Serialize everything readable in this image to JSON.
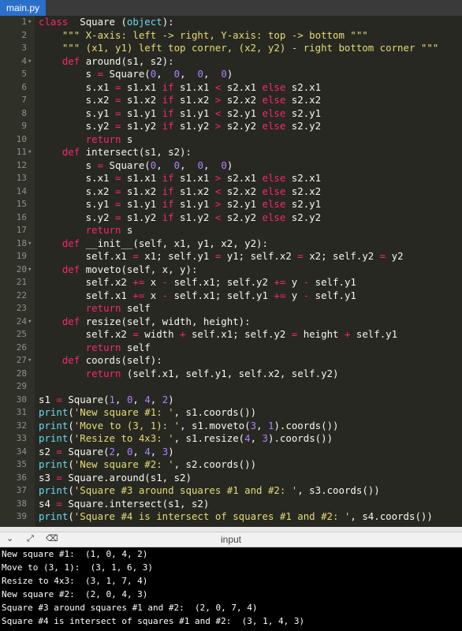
{
  "tab": {
    "filename": "main.py"
  },
  "editor": {
    "lines": [
      {
        "n": "1",
        "fold": "▾",
        "tokens": [
          [
            "kw",
            "class"
          ],
          [
            "",
            "  Square ("
          ],
          [
            "df",
            "object"
          ],
          [
            "",
            "):"
          ]
        ]
      },
      {
        "n": "2",
        "fold": "",
        "tokens": [
          [
            "",
            "    "
          ],
          [
            "st",
            "\"\"\" X-axis: left -> right, Y-axis: top -> bottom \"\"\""
          ]
        ]
      },
      {
        "n": "3",
        "fold": "",
        "tokens": [
          [
            "",
            "    "
          ],
          [
            "st",
            "\"\"\" (x1, y1) left top corner, (x2, y2) - right bottom corner \"\"\""
          ]
        ]
      },
      {
        "n": "4",
        "fold": "▾",
        "tokens": [
          [
            "",
            "    "
          ],
          [
            "kw",
            "def"
          ],
          [
            "",
            " around(s1, s2):"
          ]
        ]
      },
      {
        "n": "5",
        "fold": "",
        "tokens": [
          [
            "",
            "        s "
          ],
          [
            "op",
            "="
          ],
          [
            "",
            " Square("
          ],
          [
            "nu",
            "0"
          ],
          [
            ",",
            "  "
          ],
          [
            "nu",
            "0"
          ],
          [
            "",
            ",  "
          ],
          [
            "nu",
            "0"
          ],
          [
            "",
            ",  "
          ],
          [
            "nu",
            "0"
          ],
          [
            "",
            ")"
          ]
        ]
      },
      {
        "n": "6",
        "fold": "",
        "tokens": [
          [
            "",
            "        s.x1 "
          ],
          [
            "op",
            "="
          ],
          [
            "",
            " s1.x1 "
          ],
          [
            "kw",
            "if"
          ],
          [
            "",
            " s1.x1 "
          ],
          [
            "op",
            "<"
          ],
          [
            "",
            " s2.x1 "
          ],
          [
            "kw",
            "else"
          ],
          [
            "",
            " s2.x1"
          ]
        ]
      },
      {
        "n": "7",
        "fold": "",
        "tokens": [
          [
            "",
            "        s.x2 "
          ],
          [
            "op",
            "="
          ],
          [
            "",
            " s1.x2 "
          ],
          [
            "kw",
            "if"
          ],
          [
            "",
            " s1.x2 "
          ],
          [
            "op",
            ">"
          ],
          [
            "",
            " s2.x2 "
          ],
          [
            "kw",
            "else"
          ],
          [
            "",
            " s2.x2"
          ]
        ]
      },
      {
        "n": "8",
        "fold": "",
        "tokens": [
          [
            "",
            "        s.y1 "
          ],
          [
            "op",
            "="
          ],
          [
            "",
            " s1.y1 "
          ],
          [
            "kw",
            "if"
          ],
          [
            "",
            " s1.y1 "
          ],
          [
            "op",
            "<"
          ],
          [
            "",
            " s2.y1 "
          ],
          [
            "kw",
            "else"
          ],
          [
            "",
            " s2.y1"
          ]
        ]
      },
      {
        "n": "9",
        "fold": "",
        "tokens": [
          [
            "",
            "        s.y2 "
          ],
          [
            "op",
            "="
          ],
          [
            "",
            " s1.y2 "
          ],
          [
            "kw",
            "if"
          ],
          [
            "",
            " s1.y2 "
          ],
          [
            "op",
            ">"
          ],
          [
            "",
            " s2.y2 "
          ],
          [
            "kw",
            "else"
          ],
          [
            "",
            " s2.y2"
          ]
        ]
      },
      {
        "n": "10",
        "fold": "",
        "tokens": [
          [
            "",
            "        "
          ],
          [
            "kw",
            "return"
          ],
          [
            "",
            " s"
          ]
        ]
      },
      {
        "n": "11",
        "fold": "▾",
        "tokens": [
          [
            "",
            "    "
          ],
          [
            "kw",
            "def"
          ],
          [
            "",
            " intersect(s1, s2):"
          ]
        ]
      },
      {
        "n": "12",
        "fold": "",
        "tokens": [
          [
            "",
            "        s "
          ],
          [
            "op",
            "="
          ],
          [
            "",
            " Square("
          ],
          [
            "nu",
            "0"
          ],
          [
            ",",
            "  "
          ],
          [
            "nu",
            "0"
          ],
          [
            "",
            ",  "
          ],
          [
            "nu",
            "0"
          ],
          [
            "",
            ",  "
          ],
          [
            "nu",
            "0"
          ],
          [
            "",
            ")"
          ]
        ]
      },
      {
        "n": "13",
        "fold": "",
        "tokens": [
          [
            "",
            "        s.x1 "
          ],
          [
            "op",
            "="
          ],
          [
            "",
            " s1.x1 "
          ],
          [
            "kw",
            "if"
          ],
          [
            "",
            " s1.x1 "
          ],
          [
            "op",
            ">"
          ],
          [
            "",
            " s2.x1 "
          ],
          [
            "kw",
            "else"
          ],
          [
            "",
            " s2.x1"
          ]
        ]
      },
      {
        "n": "14",
        "fold": "",
        "tokens": [
          [
            "",
            "        s.x2 "
          ],
          [
            "op",
            "="
          ],
          [
            "",
            " s1.x2 "
          ],
          [
            "kw",
            "if"
          ],
          [
            "",
            " s1.x2 "
          ],
          [
            "op",
            "<"
          ],
          [
            "",
            " s2.x2 "
          ],
          [
            "kw",
            "else"
          ],
          [
            "",
            " s2.x2"
          ]
        ]
      },
      {
        "n": "15",
        "fold": "",
        "tokens": [
          [
            "",
            "        s.y1 "
          ],
          [
            "op",
            "="
          ],
          [
            "",
            " s1.y1 "
          ],
          [
            "kw",
            "if"
          ],
          [
            "",
            " s1.y1 "
          ],
          [
            "op",
            ">"
          ],
          [
            "",
            " s2.y1 "
          ],
          [
            "kw",
            "else"
          ],
          [
            "",
            " s2.y1"
          ]
        ]
      },
      {
        "n": "16",
        "fold": "",
        "tokens": [
          [
            "",
            "        s.y2 "
          ],
          [
            "op",
            "="
          ],
          [
            "",
            " s1.y2 "
          ],
          [
            "kw",
            "if"
          ],
          [
            "",
            " s1.y2 "
          ],
          [
            "op",
            "<"
          ],
          [
            "",
            " s2.y2 "
          ],
          [
            "kw",
            "else"
          ],
          [
            "",
            " s2.y2"
          ]
        ]
      },
      {
        "n": "17",
        "fold": "",
        "tokens": [
          [
            "",
            "        "
          ],
          [
            "kw",
            "return"
          ],
          [
            "",
            " s"
          ]
        ]
      },
      {
        "n": "18",
        "fold": "▾",
        "tokens": [
          [
            "",
            "    "
          ],
          [
            "kw",
            "def"
          ],
          [
            "",
            " __init__(self, x1, y1, x2, y2):"
          ]
        ]
      },
      {
        "n": "19",
        "fold": "",
        "tokens": [
          [
            "",
            "        self.x1 "
          ],
          [
            "op",
            "="
          ],
          [
            "",
            " x1; self.y1 "
          ],
          [
            "op",
            "="
          ],
          [
            "",
            " y1; self.x2 "
          ],
          [
            "op",
            "="
          ],
          [
            "",
            " x2; self.y2 "
          ],
          [
            "op",
            "="
          ],
          [
            "",
            " y2"
          ]
        ]
      },
      {
        "n": "20",
        "fold": "▾",
        "tokens": [
          [
            "",
            "    "
          ],
          [
            "kw",
            "def"
          ],
          [
            "",
            " moveto(self, x, y):"
          ]
        ]
      },
      {
        "n": "21",
        "fold": "",
        "tokens": [
          [
            "",
            "        self.x2 "
          ],
          [
            "op",
            "+="
          ],
          [
            "",
            " x "
          ],
          [
            "op",
            "-"
          ],
          [
            "",
            " self.x1; self.y2 "
          ],
          [
            "op",
            "+="
          ],
          [
            "",
            " y "
          ],
          [
            "op",
            "-"
          ],
          [
            "",
            " self.y1"
          ]
        ]
      },
      {
        "n": "22",
        "fold": "",
        "tokens": [
          [
            "",
            "        self.x1 "
          ],
          [
            "op",
            "+="
          ],
          [
            "",
            " x "
          ],
          [
            "op",
            "-"
          ],
          [
            "",
            " self.x1; self.y1 "
          ],
          [
            "op",
            "+="
          ],
          [
            "",
            " y "
          ],
          [
            "op",
            "-"
          ],
          [
            "",
            " self.y1"
          ]
        ]
      },
      {
        "n": "23",
        "fold": "",
        "tokens": [
          [
            "",
            "        "
          ],
          [
            "kw",
            "return"
          ],
          [
            "",
            " self"
          ]
        ]
      },
      {
        "n": "24",
        "fold": "▾",
        "tokens": [
          [
            "",
            "    "
          ],
          [
            "kw",
            "def"
          ],
          [
            "",
            " resize(self, width, height):"
          ]
        ]
      },
      {
        "n": "25",
        "fold": "",
        "tokens": [
          [
            "",
            "        self.x2 "
          ],
          [
            "op",
            "="
          ],
          [
            "",
            " width "
          ],
          [
            "op",
            "+"
          ],
          [
            "",
            " self.x1; self.y2 "
          ],
          [
            "op",
            "="
          ],
          [
            "",
            " height "
          ],
          [
            "op",
            "+"
          ],
          [
            "",
            " self.y1"
          ]
        ]
      },
      {
        "n": "26",
        "fold": "",
        "tokens": [
          [
            "",
            "        "
          ],
          [
            "kw",
            "return"
          ],
          [
            "",
            " self"
          ]
        ]
      },
      {
        "n": "27",
        "fold": "▾",
        "tokens": [
          [
            "",
            "    "
          ],
          [
            "kw",
            "def"
          ],
          [
            "",
            " coords(self):"
          ]
        ]
      },
      {
        "n": "28",
        "fold": "",
        "tokens": [
          [
            "",
            "        "
          ],
          [
            "kw",
            "return"
          ],
          [
            "",
            " (self.x1, self.y1, self.x2, self.y2)"
          ]
        ]
      },
      {
        "n": "29",
        "fold": "",
        "tokens": []
      },
      {
        "n": "30",
        "fold": "",
        "tokens": [
          [
            "",
            "s1 "
          ],
          [
            "op",
            "="
          ],
          [
            "",
            " Square("
          ],
          [
            "nu",
            "1"
          ],
          [
            "",
            ", "
          ],
          [
            "nu",
            "0"
          ],
          [
            "",
            ", "
          ],
          [
            "nu",
            "4"
          ],
          [
            "",
            ", "
          ],
          [
            "nu",
            "2"
          ],
          [
            "",
            ")"
          ]
        ]
      },
      {
        "n": "31",
        "fold": "",
        "tokens": [
          [
            "bi",
            "print"
          ],
          [
            "",
            "("
          ],
          [
            "st",
            "'New square #1: '"
          ],
          [
            "",
            ", s1.coords())"
          ]
        ]
      },
      {
        "n": "32",
        "fold": "",
        "tokens": [
          [
            "bi",
            "print"
          ],
          [
            "",
            "("
          ],
          [
            "st",
            "'Move to (3, 1): '"
          ],
          [
            "",
            ", s1.moveto("
          ],
          [
            "nu",
            "3"
          ],
          [
            "",
            ", "
          ],
          [
            "nu",
            "1"
          ],
          [
            "",
            ").coords())"
          ]
        ]
      },
      {
        "n": "33",
        "fold": "",
        "tokens": [
          [
            "bi",
            "print"
          ],
          [
            "",
            "("
          ],
          [
            "st",
            "'Resize to 4x3: '"
          ],
          [
            "",
            ", s1.resize("
          ],
          [
            "nu",
            "4"
          ],
          [
            "",
            ", "
          ],
          [
            "nu",
            "3"
          ],
          [
            "",
            ").coords())"
          ]
        ]
      },
      {
        "n": "34",
        "fold": "",
        "tokens": [
          [
            "",
            "s2 "
          ],
          [
            "op",
            "="
          ],
          [
            "",
            " Square("
          ],
          [
            "nu",
            "2"
          ],
          [
            "",
            ", "
          ],
          [
            "nu",
            "0"
          ],
          [
            "",
            ", "
          ],
          [
            "nu",
            "4"
          ],
          [
            "",
            ", "
          ],
          [
            "nu",
            "3"
          ],
          [
            "",
            ")"
          ]
        ]
      },
      {
        "n": "35",
        "fold": "",
        "tokens": [
          [
            "bi",
            "print"
          ],
          [
            "",
            "("
          ],
          [
            "st",
            "'New square #2: '"
          ],
          [
            "",
            ", s2.coords())"
          ]
        ]
      },
      {
        "n": "36",
        "fold": "",
        "tokens": [
          [
            "",
            "s3 "
          ],
          [
            "op",
            "="
          ],
          [
            "",
            " Square.around(s1, s2)"
          ]
        ]
      },
      {
        "n": "37",
        "fold": "",
        "tokens": [
          [
            "bi",
            "print"
          ],
          [
            "",
            "("
          ],
          [
            "st",
            "'Square #3 around squares #1 and #2: '"
          ],
          [
            "",
            ", s3.coords())"
          ]
        ]
      },
      {
        "n": "38",
        "fold": "",
        "tokens": [
          [
            "",
            "s4 "
          ],
          [
            "op",
            "="
          ],
          [
            "",
            " Square.intersect(s1, s2)"
          ]
        ]
      },
      {
        "n": "39",
        "fold": "",
        "tokens": [
          [
            "bi",
            "print"
          ],
          [
            "",
            "("
          ],
          [
            "st",
            "'Square #4 is intersect of squares #1 and #2: '"
          ],
          [
            "",
            ", s4.coords())"
          ]
        ]
      }
    ]
  },
  "panel": {
    "title": "input",
    "icons": [
      "chevron-down-icon",
      "expand-icon",
      "clear-console-icon"
    ]
  },
  "output": {
    "lines": [
      "New square #1:  (1, 0, 4, 2)",
      "Move to (3, 1):  (3, 1, 6, 3)",
      "Resize to 4x3:  (3, 1, 7, 4)",
      "New square #2:  (2, 0, 4, 3)",
      "Square #3 around squares #1 and #2:  (2, 0, 7, 4)",
      "Square #4 is intersect of squares #1 and #2:  (3, 1, 4, 3)"
    ]
  }
}
